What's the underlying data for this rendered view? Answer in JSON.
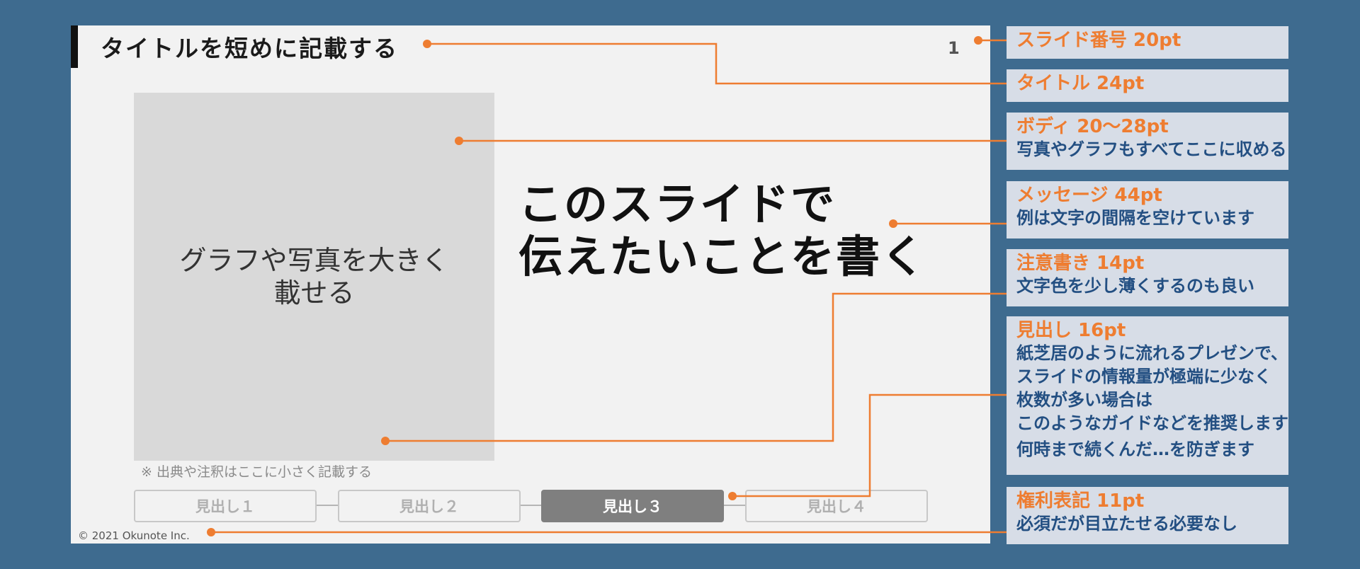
{
  "slide": {
    "title": "タイトルを短めに記載する",
    "number": "1",
    "photo_placeholder": "グラフや写真を大きく\n載せる",
    "message_line1": "このスライドで",
    "message_line2": "伝えたいことを書く",
    "note": "※ 出典や注釈はここに小さく記載する",
    "headings": [
      "見出し１",
      "見出し２",
      "見出し３",
      "見出し４"
    ],
    "active_heading_index": 2,
    "copyright": "© 2021 Okunote Inc."
  },
  "labels": [
    {
      "head": "スライド番号 20pt",
      "desc": []
    },
    {
      "head": "タイトル 24pt",
      "desc": []
    },
    {
      "head": "ボディ 20〜28pt",
      "desc": [
        "写真やグラフもすべてここに収める"
      ]
    },
    {
      "head": "メッセージ 44pt",
      "desc": [
        "例は文字の間隔を空けています"
      ]
    },
    {
      "head": "注意書き 14pt",
      "desc": [
        "文字色を少し薄くするのも良い"
      ]
    },
    {
      "head": "見出し 16pt",
      "desc": [
        "紙芝居のように流れるプレゼンで、",
        "スライドの情報量が極端に少なく",
        "枚数が多い場合は",
        "このようなガイドなどを推奨します",
        "何時まで続くんだ…を防ぎます"
      ]
    },
    {
      "head": "権利表記 11pt",
      "desc": [
        "必須だが目立たせる必要なし"
      ]
    }
  ],
  "colors": {
    "background": "#3e6b8f",
    "accent_orange": "#ee7d31",
    "label_text_blue": "#234f82",
    "label_box": "#d7dde7"
  }
}
